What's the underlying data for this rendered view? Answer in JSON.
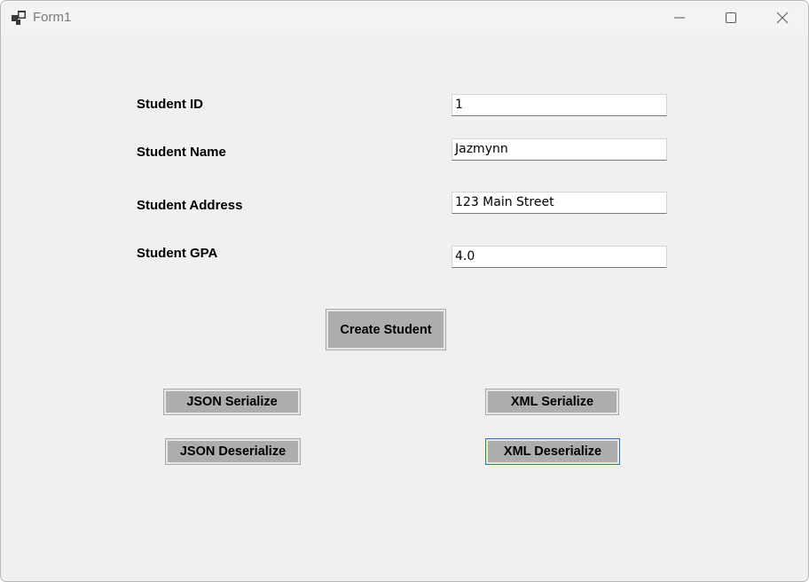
{
  "window": {
    "title": "Form1"
  },
  "form": {
    "fields": [
      {
        "label": "Student ID",
        "value": "1"
      },
      {
        "label": "Student Name",
        "value": "Jazmynn"
      },
      {
        "label": "Student Address",
        "value": "123 Main Street"
      },
      {
        "label": "Student GPA",
        "value": "4.0"
      }
    ]
  },
  "buttons": {
    "create_student": "Create Student",
    "json_serialize": "JSON Serialize",
    "json_deserialize": "JSON Deserialize",
    "xml_serialize": "XML Serialize",
    "xml_deserialize": "XML Deserialize"
  },
  "icons": {
    "app": "form-app-icon",
    "minimize": "minimize-icon",
    "maximize": "maximize-icon",
    "close": "close-icon"
  }
}
